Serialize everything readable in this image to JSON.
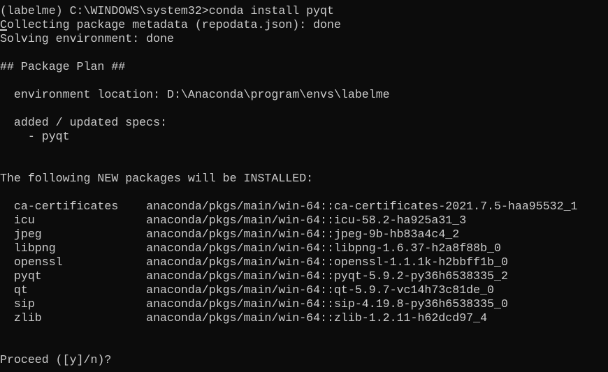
{
  "window": {
    "background": "#0c0c0c",
    "foreground": "#cccccc"
  },
  "terminal": {
    "lines": [
      "(labelme) C:\\WINDOWS\\system32>conda install pyqt",
      "Collecting package metadata (repodata.json): done",
      "Solving environment: done",
      "",
      "## Package Plan ##",
      "",
      "  environment location: D:\\Anaconda\\program\\envs\\labelme",
      "",
      "  added / updated specs:",
      "    - pyqt",
      "",
      "",
      "The following NEW packages will be INSTALLED:",
      "",
      "  ca-certificates    anaconda/pkgs/main/win-64::ca-certificates-2021.7.5-haa95532_1",
      "  icu                anaconda/pkgs/main/win-64::icu-58.2-ha925a31_3",
      "  jpeg               anaconda/pkgs/main/win-64::jpeg-9b-hb83a4c4_2",
      "  libpng             anaconda/pkgs/main/win-64::libpng-1.6.37-h2a8f88b_0",
      "  openssl            anaconda/pkgs/main/win-64::openssl-1.1.1k-h2bbff1b_0",
      "  pyqt               anaconda/pkgs/main/win-64::pyqt-5.9.2-py36h6538335_2",
      "  qt                 anaconda/pkgs/main/win-64::qt-5.9.7-vc14h73c81de_0",
      "  sip                anaconda/pkgs/main/win-64::sip-4.19.8-py36h6538335_0",
      "  zlib               anaconda/pkgs/main/win-64::zlib-1.2.11-h62dcd97_4",
      "",
      "",
      "Proceed ([y]/n)?"
    ]
  }
}
